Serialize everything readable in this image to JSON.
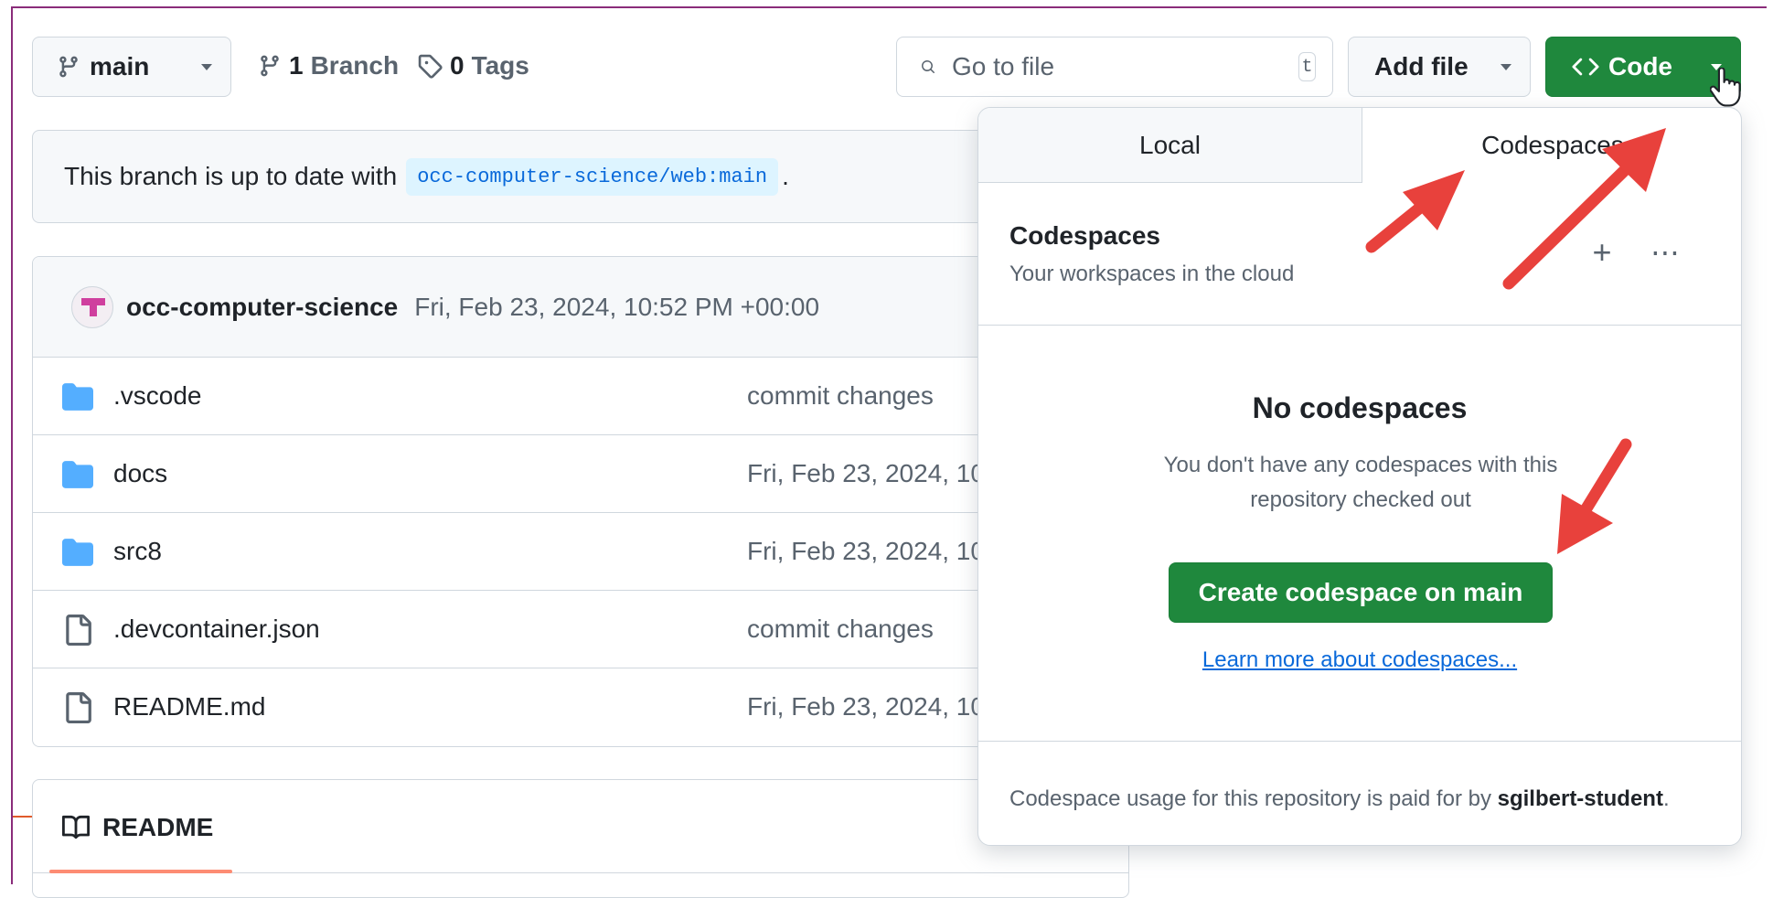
{
  "branch_selector": {
    "label": "main"
  },
  "branches": {
    "count": "1",
    "label": "Branch"
  },
  "tags": {
    "count": "0",
    "label": "Tags"
  },
  "search": {
    "placeholder": "Go to file",
    "shortcut": "t"
  },
  "add_file": {
    "label": "Add file"
  },
  "code_button": {
    "label": "Code"
  },
  "status_banner": {
    "prefix": "This branch is up to date with",
    "ref": "occ-computer-science/web:main",
    "suffix": "."
  },
  "latest_commit": {
    "author": "occ-computer-science",
    "date": "Fri, Feb 23, 2024, 10:52 PM +00:00"
  },
  "files": [
    {
      "type": "folder",
      "name": ".vscode",
      "message": "commit changes"
    },
    {
      "type": "folder",
      "name": "docs",
      "message": "Fri, Feb 23, 2024, 10"
    },
    {
      "type": "folder",
      "name": "src8",
      "message": "Fri, Feb 23, 2024, 10"
    },
    {
      "type": "file",
      "name": ".devcontainer.json",
      "message": "commit changes"
    },
    {
      "type": "file",
      "name": "README.md",
      "message": "Fri, Feb 23, 2024, 10"
    }
  ],
  "readme": {
    "tab_label": "README"
  },
  "code_panel": {
    "tabs": {
      "local": "Local",
      "codespaces": "Codespaces"
    },
    "header": {
      "title": "Codespaces",
      "subtitle": "Your workspaces in the cloud"
    },
    "empty": {
      "title": "No codespaces",
      "description": "You don't have any codespaces with this repository checked out",
      "create_button": "Create codespace on main",
      "learn_link": "Learn more about codespaces..."
    },
    "footer": {
      "text": "Codespace usage for this repository is paid for by",
      "user": "sgilbert-student",
      "suffix": "."
    }
  },
  "colors": {
    "primary_green": "#1f883d",
    "link_blue": "#0969da",
    "folder_blue": "#54aeff",
    "annotation_arrow": "#e8413c",
    "muted_text": "#59636e"
  },
  "icons": [
    "git-branch-icon",
    "tag-icon",
    "search-icon",
    "code-icon",
    "folder-icon",
    "file-icon",
    "book-icon",
    "plus-icon",
    "kebab-icon",
    "pointer-cursor-icon",
    "annotation-arrow"
  ]
}
